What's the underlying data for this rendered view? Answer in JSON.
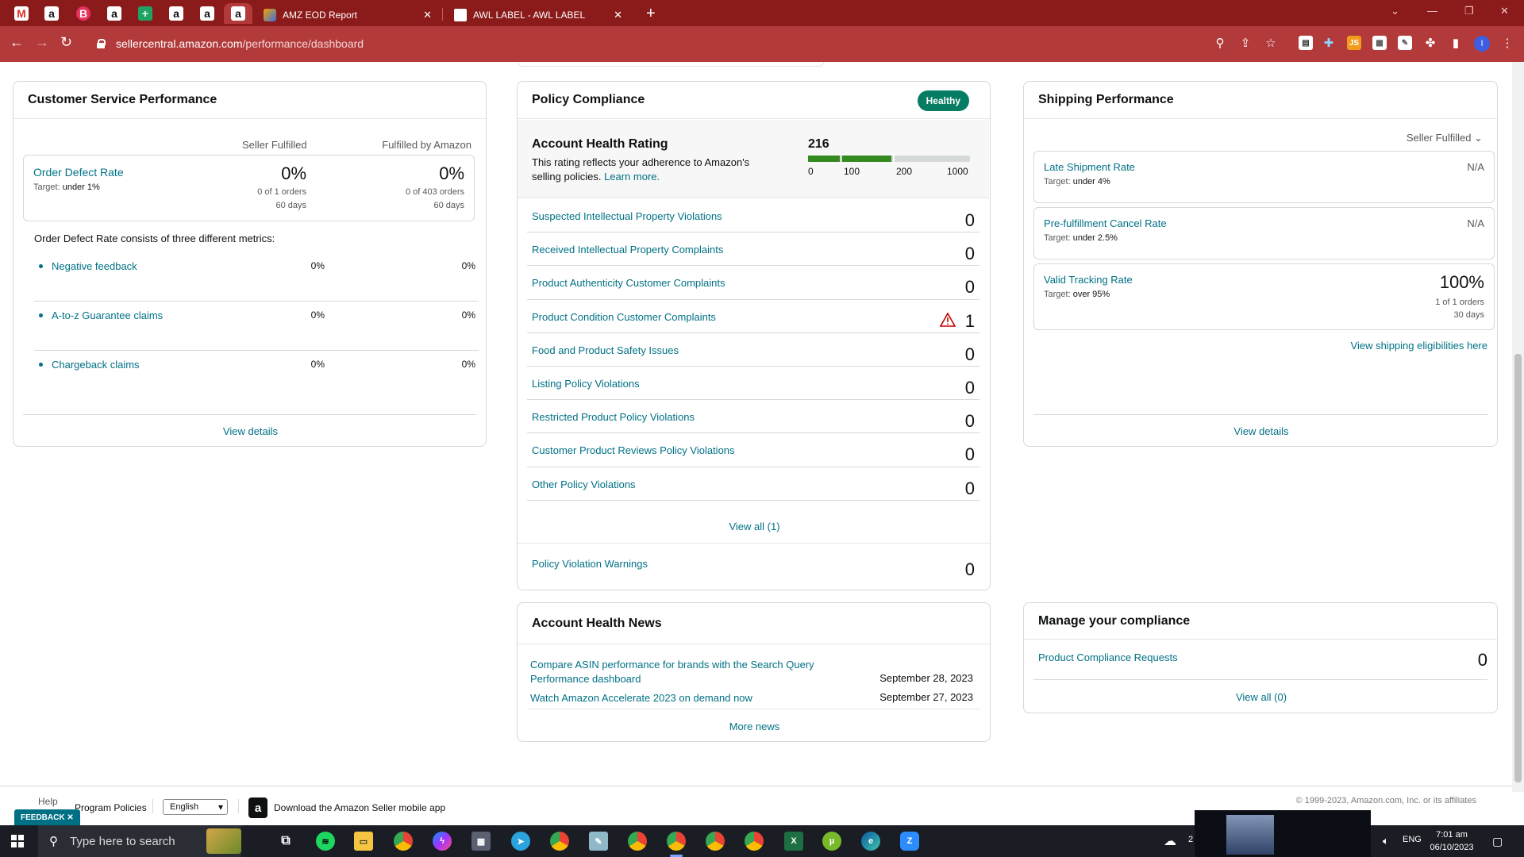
{
  "browser": {
    "tabs": [
      {
        "label": "AMZ EOD Report",
        "active": false
      },
      {
        "label": "AWL LABEL - AWL LABEL",
        "active": false
      }
    ],
    "pinned_tab_letters": [
      "M",
      "a",
      "B",
      "a",
      "+",
      "a",
      "a",
      "a"
    ],
    "url_host": "sellercentral.amazon.com",
    "url_path": "/performance/dashboard"
  },
  "customer_service": {
    "title": "Customer Service Performance",
    "col_seller": "Seller Fulfilled",
    "col_fba": "Fulfilled by Amazon",
    "odr": {
      "label": "Order Defect Rate",
      "target_prefix": "Target:",
      "target_value": "under 1%",
      "seller_pct": "0%",
      "seller_orders": "0 of 1 orders",
      "seller_days": "60 days",
      "fba_pct": "0%",
      "fba_orders": "0 of 403 orders",
      "fba_days": "60 days"
    },
    "intro": "Order Defect Rate consists of three different metrics:",
    "metrics": [
      {
        "name": "Negative feedback",
        "seller": "0%",
        "fba": "0%"
      },
      {
        "name": "A-to-z Guarantee claims",
        "seller": "0%",
        "fba": "0%"
      },
      {
        "name": "Chargeback claims",
        "seller": "0%",
        "fba": "0%"
      }
    ],
    "view_details": "View details"
  },
  "policy": {
    "title": "Policy Compliance",
    "status": "Healthy",
    "ahr_title": "Account Health Rating",
    "ahr_desc": "This rating reflects your adherence to Amazon's selling policies.",
    "learn_more": "Learn more.",
    "score": "216",
    "score_value": 216,
    "ticks": [
      "0",
      "100",
      "200",
      "1000"
    ],
    "rows": [
      {
        "name": "Suspected Intellectual Property Violations",
        "count": "0",
        "warn": false
      },
      {
        "name": "Received Intellectual Property Complaints",
        "count": "0",
        "warn": false
      },
      {
        "name": "Product Authenticity Customer Complaints",
        "count": "0",
        "warn": false
      },
      {
        "name": "Product Condition Customer Complaints",
        "count": "1",
        "warn": true
      },
      {
        "name": "Food and Product Safety Issues",
        "count": "0",
        "warn": false
      },
      {
        "name": "Listing Policy Violations",
        "count": "0",
        "warn": false
      },
      {
        "name": "Restricted Product Policy Violations",
        "count": "0",
        "warn": false
      },
      {
        "name": "Customer Product Reviews Policy Violations",
        "count": "0",
        "warn": false
      },
      {
        "name": "Other Policy Violations",
        "count": "0",
        "warn": false
      }
    ],
    "view_all": "View all (1)",
    "warnings_label": "Policy Violation Warnings",
    "warnings_count": "0"
  },
  "shipping": {
    "title": "Shipping Performance",
    "filter": "Seller Fulfilled",
    "metrics": [
      {
        "name": "Late Shipment Rate",
        "target_prefix": "Target:",
        "target_value": "under 4%",
        "value": "N/A"
      },
      {
        "name": "Pre-fulfillment Cancel Rate",
        "target_prefix": "Target:",
        "target_value": "under 2.5%",
        "value": "N/A"
      },
      {
        "name": "Valid Tracking Rate",
        "target_prefix": "Target:",
        "target_value": "over 95%",
        "value": "100%",
        "orders": "1 of 1 orders",
        "days": "30 days"
      }
    ],
    "eligibility_link": "View shipping eligibilities here",
    "view_details": "View details"
  },
  "news": {
    "title": "Account Health News",
    "items": [
      {
        "title": "Compare ASIN performance for brands with the Search Query Performance dashboard",
        "date": "September 28, 2023"
      },
      {
        "title": "Watch Amazon Accelerate 2023 on demand now",
        "date": "September 27, 2023"
      }
    ],
    "more": "More news"
  },
  "compliance": {
    "title": "Manage your compliance",
    "row_label": "Product Compliance Requests",
    "row_count": "0",
    "view_all": "View all (0)"
  },
  "footer": {
    "help": "Help",
    "program_policies": "Program Policies",
    "language": "English",
    "download_app": "Download the Amazon Seller mobile app",
    "copyright": "© 1999-2023, Amazon.com, Inc. or its affiliates",
    "feedback": "FEEDBACK"
  },
  "taskbar": {
    "search_placeholder": "Type here to search",
    "language": "ENG",
    "time": "7:01 am",
    "date": "06/10/2023",
    "weather_temp": "2"
  },
  "colors": {
    "brand_frame": "#8b1a1a",
    "link": "#007185",
    "healthy": "#067d62",
    "rating_bar": "#338a1e"
  }
}
